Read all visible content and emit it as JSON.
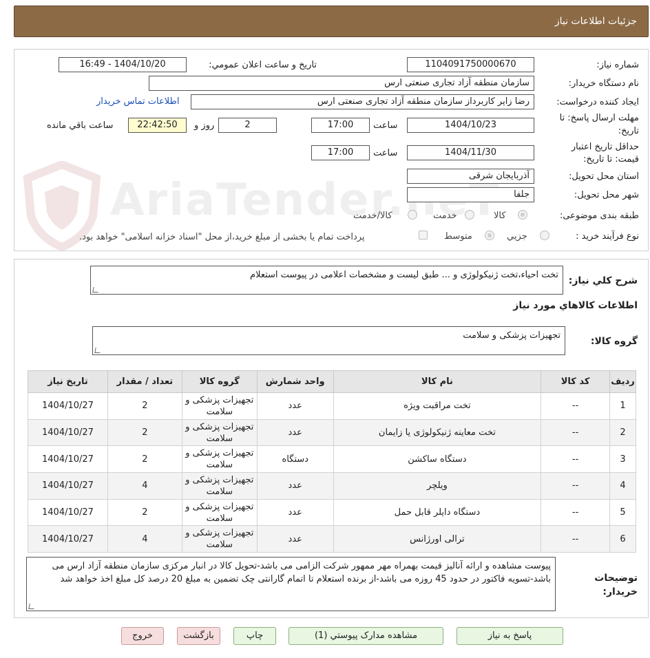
{
  "page": {
    "title": "جزئيات اطلاعات نياز"
  },
  "form": {
    "need_number_label": "شماره نياز:",
    "need_number": "1104091750000670",
    "announce_label": "تاريخ و ساعت اعلان عمومي:",
    "announce_value": "1404/10/20 - 16:49",
    "buyer_org_label": "نام دستگاه خريدار:",
    "buyer_org": "سازمان منطقه آزاد تجاری صنعتی ارس",
    "requester_label": "ايجاد کننده درخواست:",
    "requester": "رضا زاير کاربرداز سازمان منطقه آزاد تجاری صنعتی ارس",
    "contact_link": "اطلاعات تماس خريدار",
    "reply_deadline_label_1": "مهلت ارسال پاسخ: تا",
    "reply_deadline_label_2": "تاريخ:",
    "reply_date": "1404/10/23",
    "time_label": "ساعت",
    "reply_time": "17:00",
    "days_value": "2",
    "days_label": "روز و",
    "remaining_time": "22:42:50",
    "remaining_label": "ساعت باقي مانده",
    "validity_label_1": "حداقل تاريخ اعتبار",
    "validity_label_2": "قيمت: تا تاريخ:",
    "validity_date": "1404/11/30",
    "validity_time": "17:00",
    "province_label": "استان محل تحويل:",
    "province": "آذربايجان شرقی",
    "city_label": "شهر محل تحويل:",
    "city": "جلفا",
    "category_label": "طبقه بندی موضوعی:",
    "category_options": [
      "کالا",
      "خدمت",
      "کالا/خدمت"
    ],
    "purchase_type_label": "نوع فرآيند خريد :",
    "purchase_options": [
      "جزيي",
      "متوسط"
    ],
    "treasury_note": "پرداخت تمام يا بخشی از مبلغ خريد،از محل \"اسناد خزانه اسلامی\" خواهد بود."
  },
  "summary": {
    "label": "شرح کلي نياز:",
    "text": "تخت احياء،تخت ژنیکولوژی و ... طبق لیست و مشخصات اعلامی در پیوست استعلام"
  },
  "goods": {
    "section_title": "اطلاعات کالاهاي مورد نياز",
    "group_label": "گروه کالا:",
    "group_value": "تجهيزات پزشکی و سلامت"
  },
  "table": {
    "headers": [
      "رديف",
      "کد کالا",
      "نام کالا",
      "واحد شمارش",
      "گروه کالا",
      "تعداد / مقدار",
      "تاريخ نياز"
    ],
    "rows": [
      [
        "1",
        "--",
        "تخت مراقبت ویژه",
        "عدد",
        "تجهيزات پزشکی و سلامت",
        "2",
        "1404/10/27"
      ],
      [
        "2",
        "--",
        "تخت معاینه ژنیکولوژی یا زایمان",
        "عدد",
        "تجهيزات پزشکی و سلامت",
        "2",
        "1404/10/27"
      ],
      [
        "3",
        "--",
        "دستگاه ساکشن",
        "دستگاه",
        "تجهيزات پزشکی و سلامت",
        "2",
        "1404/10/27"
      ],
      [
        "4",
        "--",
        "ویلچر",
        "عدد",
        "تجهيزات پزشکی و سلامت",
        "4",
        "1404/10/27"
      ],
      [
        "5",
        "--",
        "دستگاه دایلر قابل حمل",
        "عدد",
        "تجهيزات پزشکی و سلامت",
        "2",
        "1404/10/27"
      ],
      [
        "6",
        "--",
        "ترالی اورژانس",
        "عدد",
        "تجهيزات پزشکی و سلامت",
        "4",
        "1404/10/27"
      ]
    ]
  },
  "buyer_notes": {
    "label_1": "توضيحات",
    "label_2": "خريدار:",
    "text": "پيوست مشاهده و ارائه آناليز قيمت بهمراه مهر ممهور شرکت الزامی می باشد-تحويل کالا در انبار مرکزی سازمان منطقه آزاد ارس می باشد-تسويه فاکتور در حدود 45 روزه می باشد-از برنده استعلام تا اتمام گارانتی چک تضمين به مبلغ 20 درصد کل مبلغ اخذ خواهد شد"
  },
  "buttons": {
    "reply": "پاسخ به نياز",
    "attachments": "مشاهده مدارک پيوستي (1)",
    "print": "چاپ",
    "back": "بازگشت",
    "exit": "خروج"
  },
  "watermark": {
    "text": "AriaTender.neT"
  }
}
